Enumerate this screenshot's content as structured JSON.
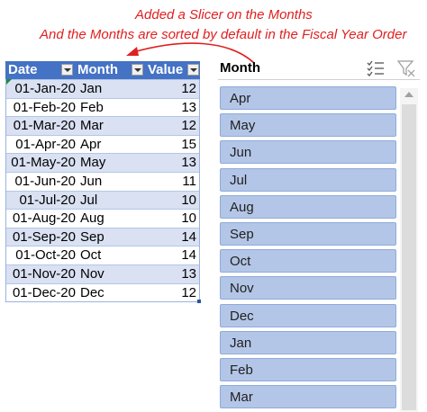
{
  "annotation": {
    "line1": "Added a Slicer on the Months",
    "line2": "And the Months are sorted by default in the Fiscal Year Order"
  },
  "colors": {
    "annotation": "#e02020",
    "header_bg": "#4472c4",
    "band_row": "#d9e1f2",
    "slicer_item": "#b4c6e7"
  },
  "table": {
    "headers": {
      "date": "Date",
      "month": "Month",
      "value": "Value"
    },
    "rows": [
      {
        "date": "01-Jan-20",
        "month": "Jan",
        "value": "12"
      },
      {
        "date": "01-Feb-20",
        "month": "Feb",
        "value": "13"
      },
      {
        "date": "01-Mar-20",
        "month": "Mar",
        "value": "12"
      },
      {
        "date": "01-Apr-20",
        "month": "Apr",
        "value": "15"
      },
      {
        "date": "01-May-20",
        "month": "May",
        "value": "13"
      },
      {
        "date": "01-Jun-20",
        "month": "Jun",
        "value": "11"
      },
      {
        "date": "01-Jul-20",
        "month": "Jul",
        "value": "10"
      },
      {
        "date": "01-Aug-20",
        "month": "Aug",
        "value": "10"
      },
      {
        "date": "01-Sep-20",
        "month": "Sep",
        "value": "14"
      },
      {
        "date": "01-Oct-20",
        "month": "Oct",
        "value": "14"
      },
      {
        "date": "01-Nov-20",
        "month": "Nov",
        "value": "13"
      },
      {
        "date": "01-Dec-20",
        "month": "Dec",
        "value": "12"
      }
    ]
  },
  "slicer": {
    "title": "Month",
    "icons": [
      "multi-select-icon",
      "clear-filter-icon"
    ],
    "items": [
      "Apr",
      "May",
      "Jun",
      "Jul",
      "Aug",
      "Sep",
      "Oct",
      "Nov",
      "Dec",
      "Jan",
      "Feb",
      "Mar"
    ]
  }
}
